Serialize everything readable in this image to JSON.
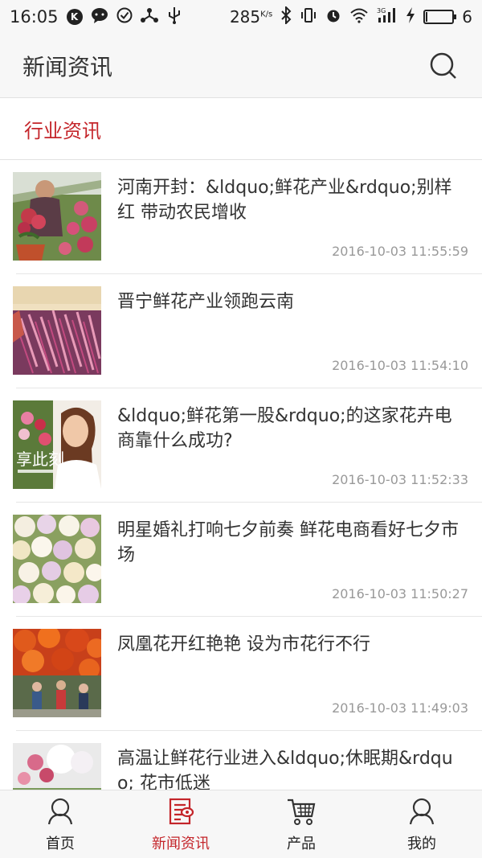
{
  "status_bar": {
    "time": "16:05",
    "speed_value": "285",
    "speed_unit": "K/s",
    "network": "3G",
    "battery_level": "6"
  },
  "header": {
    "title": "新闻资讯",
    "search_icon": "search-icon"
  },
  "section": {
    "title": "行业资讯"
  },
  "news": [
    {
      "title": "河南开封：&ldquo;鲜花产业&rdquo;别样红 带动农民增收",
      "time": "2016-10-03 11:55:59"
    },
    {
      "title": "晋宁鲜花产业领跑云南",
      "time": "2016-10-03 11:54:10"
    },
    {
      "title": "&ldquo;鲜花第一股&rdquo;的这家花卉电商靠什么成功?",
      "time": "2016-10-03 11:52:33"
    },
    {
      "title": "明星婚礼打响七夕前奏 鲜花电商看好七夕市场",
      "time": "2016-10-03 11:50:27"
    },
    {
      "title": "凤凰花开红艳艳 设为市花行不行",
      "time": "2016-10-03 11:49:03"
    },
    {
      "title": "高温让鲜花行业进入&ldquo;休眠期&rdquo; 花市低迷",
      "time": ""
    }
  ],
  "thumb_overlay_text": "享此刻",
  "bottom_nav": [
    {
      "label": "首页",
      "icon": "user-icon",
      "active": false
    },
    {
      "label": "新闻资讯",
      "icon": "news-icon",
      "active": true
    },
    {
      "label": "产品",
      "icon": "cart-icon",
      "active": false
    },
    {
      "label": "我的",
      "icon": "profile-icon",
      "active": false
    }
  ],
  "colors": {
    "accent": "#c4252a",
    "text": "#333333",
    "muted": "#999999",
    "bar_bg": "#f7f7f7"
  }
}
